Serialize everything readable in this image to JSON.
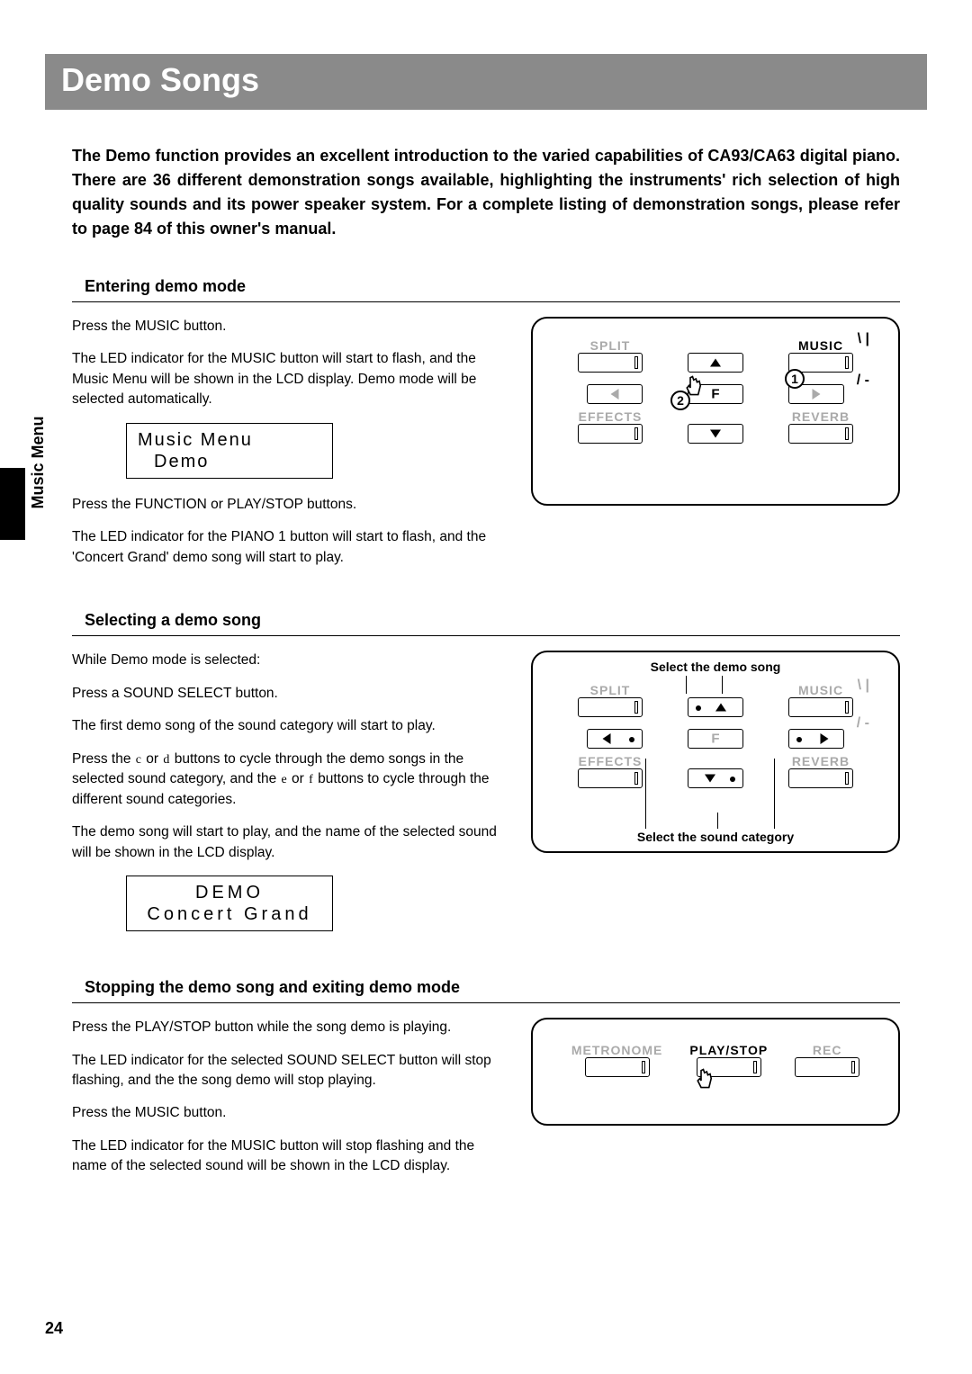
{
  "page_number": "24",
  "side_label": "Music Menu",
  "title": "Demo Songs",
  "intro": "The Demo function provides an excellent introduction to the varied capabilities of CA93/CA63 digital piano. There are 36 different demonstration songs available, highlighting the instruments' rich selection of high quality sounds and its power speaker system.  For a complete listing of demonstration songs, please refer to page 84 of this owner's manual.",
  "section1": {
    "heading": "Entering demo mode",
    "p1": "Press the MUSIC button.",
    "p2": "The LED indicator for the MUSIC button will start to flash, and the Music Menu will be shown in the LCD display.  Demo mode will be selected automatically.",
    "lcd_line1": "Music Menu",
    "lcd_line2": "Demo",
    "p3": "Press the FUNCTION or PLAY/STOP buttons.",
    "p4": "The LED indicator for the PIANO 1 button will start to flash, and the 'Concert Grand' demo song will start to play."
  },
  "section2": {
    "heading": "Selecting a demo song",
    "p1": "While Demo mode is selected:",
    "p2": "Press a SOUND SELECT button.",
    "p3": "The first demo song of the sound category will start to play.",
    "p4a": "Press the ",
    "p4b": " or ",
    "p4c": " buttons to cycle through the demo songs in the selected sound category, and the ",
    "p4d": " or ",
    "p4e": " buttons to cycle through the different sound categories.",
    "p5": "The demo song will start to play, and the name of the selected sound will be shown in the LCD display.",
    "lcd_line1": "DEMO",
    "lcd_line2": "Concert Grand",
    "caption_top": "Select the demo song",
    "caption_bottom": "Select the sound category"
  },
  "section3": {
    "heading": "Stopping the demo song and exiting demo mode",
    "p1": "Press the PLAY/STOP button while the song demo is playing.",
    "p2": "The LED indicator for the selected SOUND SELECT button will stop flashing, and the the song demo will stop playing.",
    "p3": "Press the MUSIC button.",
    "p4": "The LED indicator for the MUSIC button will stop flashing and the name of the selected sound will be shown in the LCD display."
  },
  "panel_labels": {
    "split": "SPLIT",
    "music": "MUSIC",
    "effects": "EFFECTS",
    "reverb": "REVERB",
    "metronome": "METRONOME",
    "playstop": "PLAY/STOP",
    "rec": "REC",
    "f": "F",
    "badge1": "1",
    "badge2": "2"
  },
  "tokens": {
    "c": "c",
    "d": "d",
    "e": "e",
    "f": "f"
  }
}
